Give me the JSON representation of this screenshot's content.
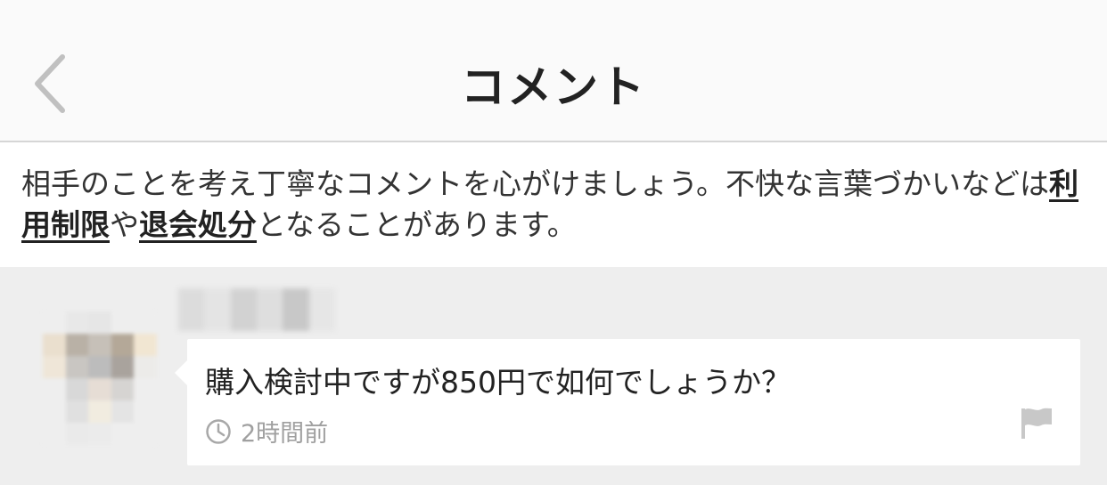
{
  "header": {
    "title": "コメント",
    "back_icon": "chevron-left-icon"
  },
  "notice": {
    "part1": "相手のことを考え丁寧なコメントを心がけましょう。不快な言葉づかいなどは",
    "emph1": "利用制限",
    "part2": "や",
    "emph2": "退会処分",
    "part3": "となることがあります。"
  },
  "comments": [
    {
      "text": "購入検討中ですが850円で如何でしょうか？",
      "time": "2時間前",
      "time_icon": "clock-icon",
      "report_icon": "flag-icon"
    }
  ],
  "colors": {
    "header_bg": "#fafafa",
    "notice_bg": "#ffffff",
    "comment_area_bg": "#eeeeee",
    "muted_text": "#a0a0a0",
    "icon_gray": "#c8c8c8"
  }
}
